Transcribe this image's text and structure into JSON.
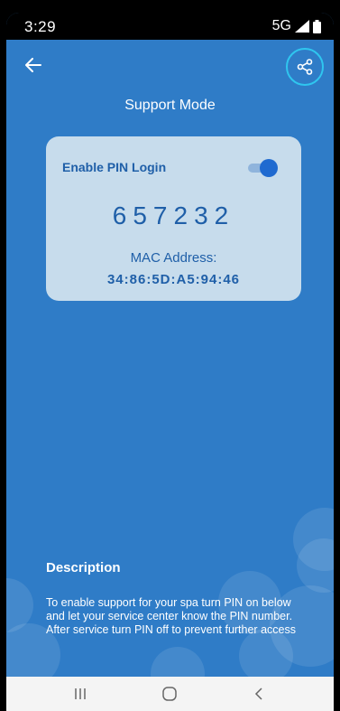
{
  "status_bar": {
    "time": "3:29",
    "network": "5G"
  },
  "header": {
    "title": "Support Mode",
    "back_icon": "arrow-left-icon",
    "share_icon": "share-icon",
    "share_highlight_color": "#2fc6ef"
  },
  "pin_card": {
    "toggle_label": "Enable PIN Login",
    "toggle_state": "on",
    "pin": "657232",
    "mac_label": "MAC Address:",
    "mac_value": "34:86:5D:A5:94:46"
  },
  "description": {
    "title": "Description",
    "body": "To enable support for your spa turn PIN on below and let your service center know the PIN number. After service turn PIN off to prevent further access"
  },
  "nav_bar": {
    "items": [
      "recents-icon",
      "home-icon",
      "back-chevron-icon"
    ]
  },
  "colors": {
    "background": "#2f7cc7",
    "card": "#c7dcec",
    "accent": "#1f5fa8",
    "toggle_thumb": "#1f6ad0"
  }
}
